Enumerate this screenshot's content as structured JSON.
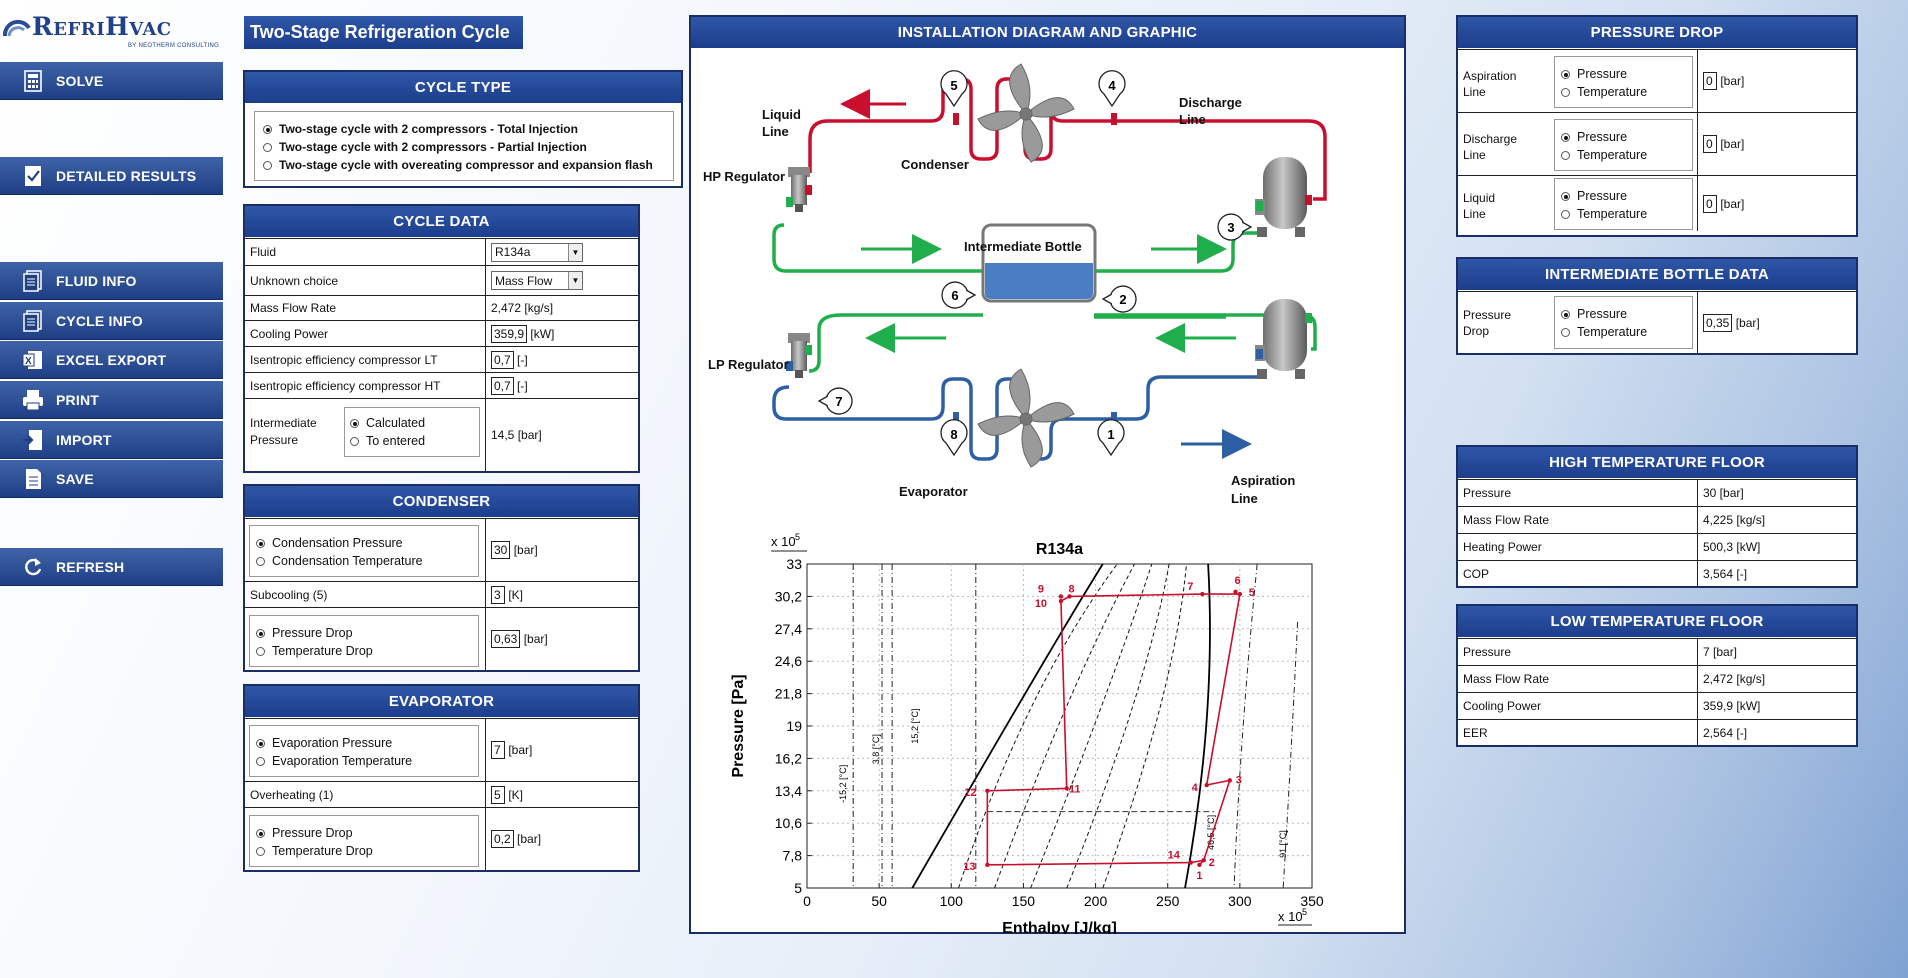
{
  "app": {
    "logo_text": "RefriHvac",
    "logo_sub": "BY NEOTHERM CONSULTING",
    "page_title": "Two-Stage Refrigeration Cycle"
  },
  "colors": {
    "accent": "#1c3d8c",
    "hot": "#c8102e",
    "cold": "#2e5fa3",
    "mid": "#1fae4b"
  },
  "nav": [
    {
      "label": "SOLVE",
      "icon": "calculator-icon"
    },
    {
      "label": "DETAILED RESULTS",
      "icon": "checklist-icon"
    },
    {
      "label": "FLUID INFO",
      "icon": "document-icon"
    },
    {
      "label": "CYCLE INFO",
      "icon": "document-icon"
    },
    {
      "label": "EXCEL EXPORT",
      "icon": "excel-icon"
    },
    {
      "label": "PRINT",
      "icon": "printer-icon"
    },
    {
      "label": "IMPORT",
      "icon": "import-icon"
    },
    {
      "label": "SAVE",
      "icon": "save-icon"
    },
    {
      "label": "REFRESH",
      "icon": "refresh-icon"
    }
  ],
  "cycle_type": {
    "title": "CYCLE TYPE",
    "options": [
      "Two-stage cycle with 2 compressors - Total Injection",
      "Two-stage cycle with 2 compressors - Partial Injection",
      "Two-stage cycle with overeating compressor and expansion flash"
    ],
    "selected": 0
  },
  "cycle_data": {
    "title": "CYCLE DATA",
    "fluid_label": "Fluid",
    "fluid_value": "R134a",
    "unknown_label": "Unknown choice",
    "unknown_value": "Mass Flow",
    "mass_flow_label": "Mass Flow Rate",
    "mass_flow_value": "2,472 [kg/s]",
    "cooling_label": "Cooling Power",
    "cooling_value": "359,9",
    "cooling_unit": "[kW]",
    "eff_lt_label": "Isentropic efficiency compressor LT",
    "eff_lt_value": "0,7",
    "eff_lt_unit": "[-]",
    "eff_ht_label": "Isentropic efficiency compressor HT",
    "eff_ht_value": "0,7",
    "eff_ht_unit": "[-]",
    "interm_label_1": "Intermediate",
    "interm_label_2": "Pressure",
    "interm_opt1": "Calculated",
    "interm_opt2": "To entered",
    "interm_value": "14,5 [bar]"
  },
  "condenser": {
    "title": "CONDENSER",
    "opt1": "Condensation Pressure",
    "opt2": "Condensation Temperature",
    "value": "30",
    "unit": "[bar]",
    "subcool_label": "Subcooling (5)",
    "subcool_value": "3",
    "subcool_unit": "[K]",
    "drop_opt1": "Pressure Drop",
    "drop_opt2": "Temperature Drop",
    "drop_value": "0,63",
    "drop_unit": "[bar]"
  },
  "evaporator": {
    "title": "EVAPORATOR",
    "opt1": "Evaporation Pressure",
    "opt2": "Evaporation Temperature",
    "value": "7",
    "unit": "[bar]",
    "overheat_label": "Overheating (1)",
    "overheat_value": "5",
    "overheat_unit": "[K]",
    "drop_opt1": "Pressure Drop",
    "drop_opt2": "Temperature Drop",
    "drop_value": "0,2",
    "drop_unit": "[bar]"
  },
  "diagram": {
    "title": "INSTALLATION DIAGRAM AND GRAPHIC",
    "labels": {
      "liquid_line": [
        "Liquid",
        "Line"
      ],
      "discharge_line": [
        "Discharge",
        "Line"
      ],
      "condenser": "Condenser",
      "hp_regulator": "HP Regulator",
      "intermediate_bottle": "Intermediate Bottle",
      "lp_regulator": "LP Regulator",
      "evaporator": "Evaporator",
      "aspiration_line": [
        "Aspiration",
        "Line"
      ]
    },
    "points": [
      "1",
      "2",
      "3",
      "4",
      "5",
      "6",
      "7",
      "8"
    ]
  },
  "chart_data": {
    "type": "line",
    "title": "R134a",
    "xlabel": "Enthalpy [J/kg]",
    "ylabel": "Pressure [Pa]",
    "x_scale_label": "x 10",
    "x_scale_exp": "5",
    "y_scale_label": "x 10",
    "y_scale_exp": "5",
    "xlim": [
      0,
      350
    ],
    "ylim": [
      5,
      33
    ],
    "xticks": [
      0,
      50,
      100,
      150,
      200,
      250,
      300,
      350
    ],
    "yticks": [
      "5",
      "7,8",
      "10,6",
      "13,4",
      "16,2",
      "19",
      "21,8",
      "24,6",
      "27,4",
      "30,2",
      "33"
    ],
    "isotherm_labels": [
      "-15,2 [°C]",
      "3,8 [°C]",
      "15,2 [°C]",
      "46,5 [°C]",
      "91 [°C]"
    ],
    "cycle_points": [
      {
        "id": "1",
        "h": 272,
        "p": 7.0
      },
      {
        "id": "2",
        "h": 275,
        "p": 7.4
      },
      {
        "id": "3",
        "h": 293,
        "p": 14.3
      },
      {
        "id": "4",
        "h": 277,
        "p": 13.9
      },
      {
        "id": "5",
        "h": 300,
        "p": 30.4
      },
      {
        "id": "6",
        "h": 297,
        "p": 30.6
      },
      {
        "id": "7",
        "h": 274,
        "p": 30.4
      },
      {
        "id": "8",
        "h": 182,
        "p": 30.2
      },
      {
        "id": "9",
        "h": 176,
        "p": 30.2
      },
      {
        "id": "10",
        "h": 176,
        "p": 29.8
      },
      {
        "id": "11",
        "h": 180,
        "p": 13.6
      },
      {
        "id": "12",
        "h": 125,
        "p": 13.4
      },
      {
        "id": "13",
        "h": 125,
        "p": 7.0
      },
      {
        "id": "14",
        "h": 266,
        "p": 7.2
      }
    ]
  },
  "pressure_drop": {
    "title": "PRESSURE DROP",
    "opt1": "Pressure",
    "opt2": "Temperature",
    "rows": [
      {
        "l1": "Aspiration",
        "l2": "Line",
        "value": "0",
        "unit": "[bar]"
      },
      {
        "l1": "Discharge",
        "l2": "Line",
        "value": "0",
        "unit": "[bar]"
      },
      {
        "l1": "Liquid",
        "l2": "Line",
        "value": "0",
        "unit": "[bar]"
      }
    ]
  },
  "bottle": {
    "title": "INTERMEDIATE BOTTLE DATA",
    "l1": "Pressure",
    "l2": "Drop",
    "opt1": "Pressure",
    "opt2": "Temperature",
    "value": "0,35",
    "unit": "[bar]"
  },
  "high_floor": {
    "title": "HIGH TEMPERATURE FLOOR",
    "rows": [
      [
        "Pressure",
        "30 [bar]"
      ],
      [
        "Mass Flow Rate",
        "4,225 [kg/s]"
      ],
      [
        "Heating Power",
        "500,3 [kW]"
      ],
      [
        "COP",
        "3,564 [-]"
      ]
    ]
  },
  "low_floor": {
    "title": "LOW TEMPERATURE FLOOR",
    "rows": [
      [
        "Pressure",
        "7 [bar]"
      ],
      [
        "Mass Flow Rate",
        "2,472 [kg/s]"
      ],
      [
        "Cooling Power",
        "359,9 [kW]"
      ],
      [
        "EER",
        "2,564 [-]"
      ]
    ]
  }
}
